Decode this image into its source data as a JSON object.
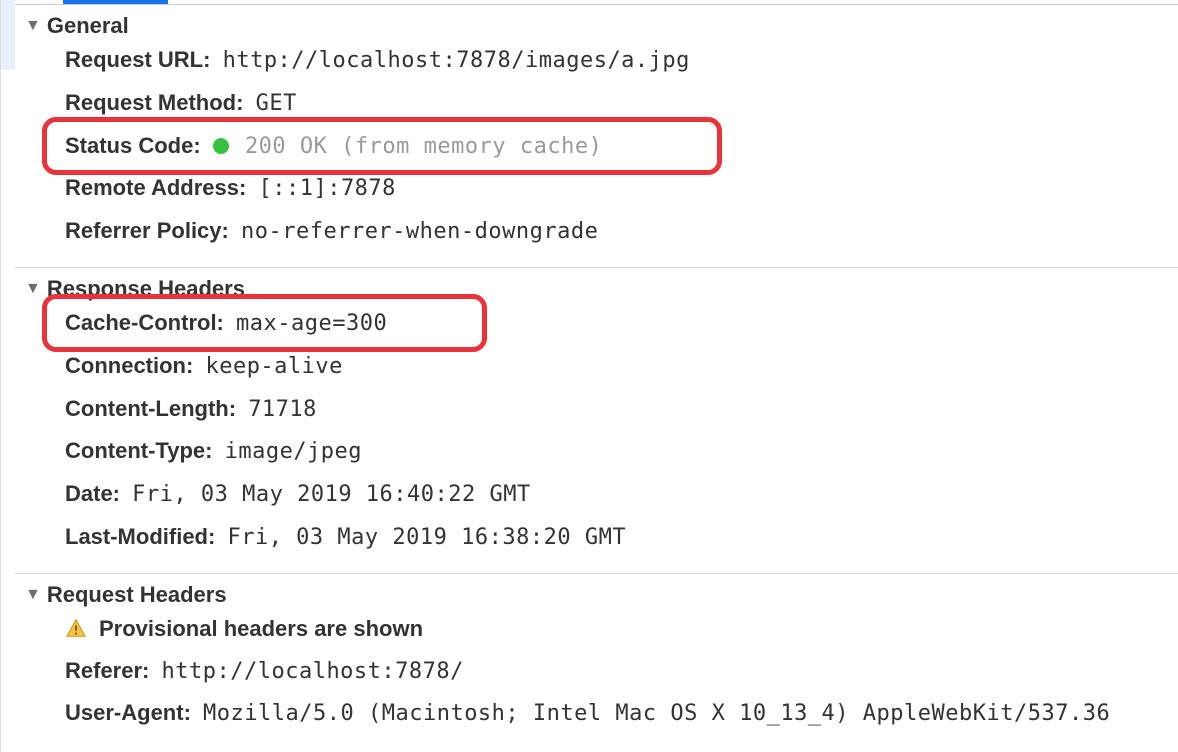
{
  "sections": {
    "general": {
      "title": "General",
      "request_url": {
        "label": "Request URL:",
        "value": "http://localhost:7878/images/a.jpg"
      },
      "request_method": {
        "label": "Request Method:",
        "value": "GET"
      },
      "status_code": {
        "label": "Status Code:",
        "value": "200 OK (from memory cache)"
      },
      "remote_address": {
        "label": "Remote Address:",
        "value": "[::1]:7878"
      },
      "referrer_policy": {
        "label": "Referrer Policy:",
        "value": "no-referrer-when-downgrade"
      }
    },
    "response_headers": {
      "title": "Response Headers",
      "cache_control": {
        "label": "Cache-Control:",
        "value": "max-age=300"
      },
      "connection": {
        "label": "Connection:",
        "value": "keep-alive"
      },
      "content_length": {
        "label": "Content-Length:",
        "value": "71718"
      },
      "content_type": {
        "label": "Content-Type:",
        "value": "image/jpeg"
      },
      "date": {
        "label": "Date:",
        "value": "Fri, 03 May 2019 16:40:22 GMT"
      },
      "last_modified": {
        "label": "Last-Modified:",
        "value": "Fri, 03 May 2019 16:38:20 GMT"
      }
    },
    "request_headers": {
      "title": "Request Headers",
      "provisional_warning": "Provisional headers are shown",
      "referer": {
        "label": "Referer:",
        "value": "http://localhost:7878/"
      },
      "user_agent": {
        "label": "User-Agent:",
        "value": "Mozilla/5.0 (Macintosh; Intel Mac OS X 10_13_4) AppleWebKit/537.36"
      }
    }
  }
}
